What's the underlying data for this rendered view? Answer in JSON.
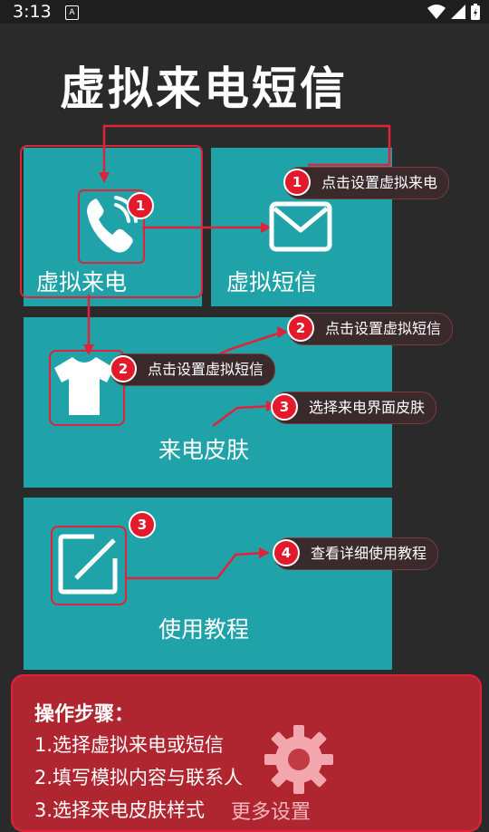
{
  "status": {
    "time": "3:13",
    "indicator": "A"
  },
  "app": {
    "title": "虚拟来电短信"
  },
  "tiles": {
    "call": {
      "label": "虚拟来电"
    },
    "sms": {
      "label": "虚拟短信"
    },
    "skin": {
      "label": "来电皮肤"
    },
    "tutorial": {
      "label": "使用教程"
    },
    "settings": {
      "label": "更多设置"
    }
  },
  "callouts": {
    "c1": {
      "number": "1",
      "text": "点击设置虚拟来电"
    },
    "c2a": {
      "number": "2",
      "text": "点击设置虚拟短信"
    },
    "c2b": {
      "number": "2",
      "text": "点击设置虚拟短信"
    },
    "c3": {
      "number": "3",
      "text": "选择来电界面皮肤"
    },
    "c4": {
      "number": "4",
      "text": "查看详细使用教程"
    }
  },
  "badges": {
    "phone": "1",
    "tutorial": "3"
  },
  "steps": {
    "title": "操作步骤：",
    "items": [
      "1.选择虚拟来电或短信",
      "2.填写模拟内容与联系人",
      "3.选择来电皮肤样式"
    ]
  },
  "colors": {
    "tile": "#1fa3a8",
    "accent_red": "#e0233a",
    "panel_red": "#ba2630",
    "background": "#2a2a2a"
  },
  "icons": [
    "phone-icon",
    "mail-icon",
    "tshirt-icon",
    "edit-icon",
    "gear-icon",
    "wifi-icon",
    "signal-icon",
    "battery-icon"
  ]
}
